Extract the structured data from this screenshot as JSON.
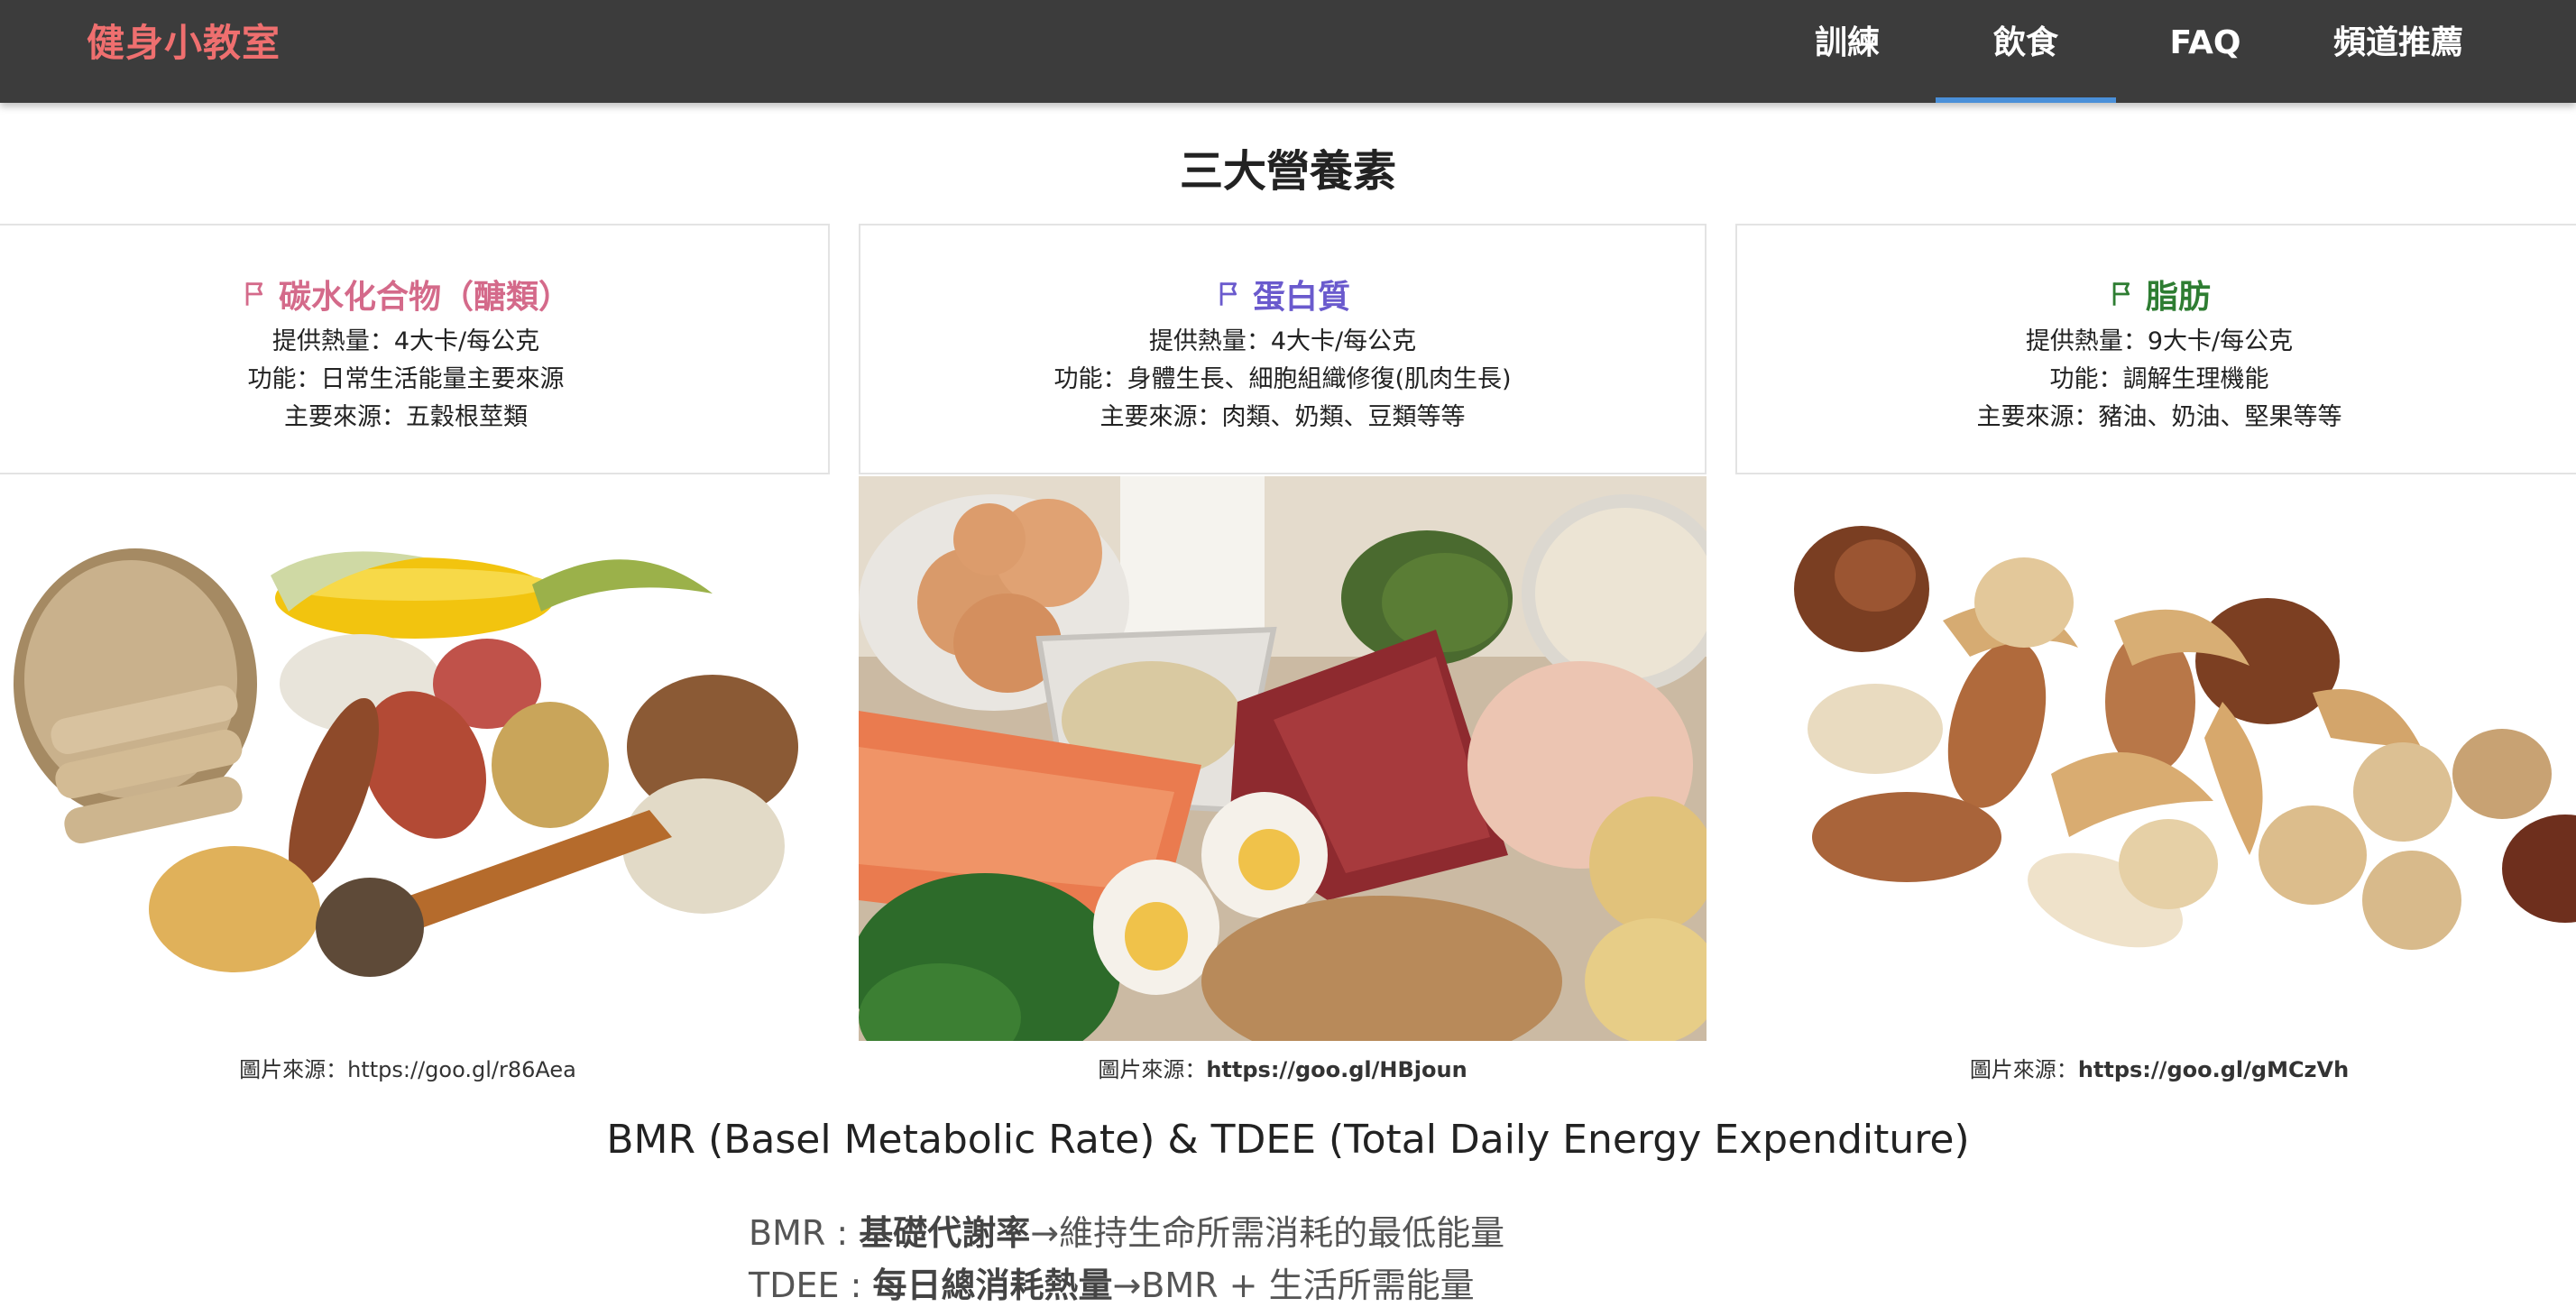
{
  "nav": {
    "brand": "健身小教室",
    "items": [
      {
        "label": "訓練"
      },
      {
        "label": "飲食"
      },
      {
        "label": "FAQ"
      },
      {
        "label": "頻道推薦"
      }
    ],
    "active": "飲食"
  },
  "section_title": "三大營養素",
  "cards": [
    {
      "title": "碳水化合物（醣類）",
      "title_color": "#d46a8a",
      "calories": "提供熱量：4大卡/每公克",
      "function": "功能：日常生活能量主要來源",
      "source": "主要來源：五穀根莖類",
      "caption_prefix": "圖片來源：",
      "caption_url": "https://goo.gl/r86Aea"
    },
    {
      "title": "蛋白質",
      "title_color": "#6a5acd",
      "calories": "提供熱量：4大卡/每公克",
      "function": "功能：身體生長、細胞組織修復(肌肉生長)",
      "source": "主要來源：肉類、奶類、豆類等等",
      "caption_prefix": "圖片來源：",
      "caption_url": "https://goo.gl/HBjoun"
    },
    {
      "title": "脂肪",
      "title_color": "#2e7d32",
      "calories": "提供熱量：9大卡/每公克",
      "function": "功能：調解生理機能",
      "source": "主要來源：豬油、奶油、堅果等等",
      "caption_prefix": "圖片來源：",
      "caption_url": "https://goo.gl/gMCzVh"
    }
  ],
  "bmr_section": {
    "title": "BMR (Basel Metabolic Rate) & TDEE (Total Daily Energy Expenditure)",
    "bmr_prefix": "BMR : ",
    "bmr_keyword": "基礎代謝率",
    "bmr_rest": "→維持生命所需消耗的最低能量",
    "tdee_prefix": "TDEE : ",
    "tdee_keyword": "每日總消耗熱量",
    "tdee_rest": "→BMR + 生活所需能量"
  },
  "colors": {
    "navbar_bg": "#3c3c3c",
    "brand": "#ef6f6f",
    "active_underline": "#4a90d9"
  },
  "icons": {
    "card_flag": "flag-icon"
  }
}
